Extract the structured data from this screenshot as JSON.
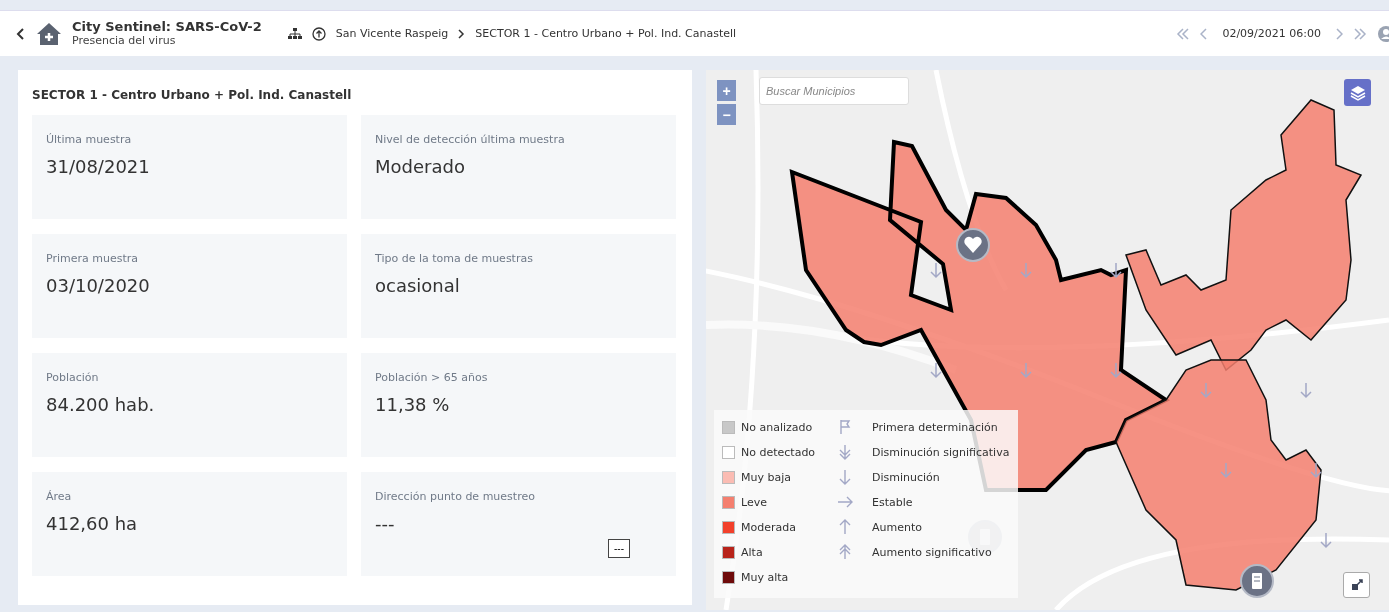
{
  "header": {
    "title": "City Sentinel: SARS-CoV-2",
    "subtitle": "Presencia del virus",
    "breadcrumbs": [
      "San Vicente Raspeig",
      "SECTOR 1 - Centro Urbano + Pol. Ind. Canastell"
    ],
    "date": "02/09/2021 06:00"
  },
  "panel": {
    "title": "SECTOR 1 - Centro Urbano + Pol. Ind. Canastell",
    "cards": [
      {
        "label": "Última muestra",
        "value": "31/08/2021"
      },
      {
        "label": "Nivel de detección última muestra",
        "value": "Moderado"
      },
      {
        "label": "Primera muestra",
        "value": "03/10/2020"
      },
      {
        "label": "Tipo de la toma de muestras",
        "value": "ocasional"
      },
      {
        "label": "Población",
        "value": "84.200 hab."
      },
      {
        "label": "Población > 65 años",
        "value": "11,38 %"
      },
      {
        "label": "Área",
        "value": "412,60 ha"
      },
      {
        "label": "Dirección punto de muestreo",
        "value": "---",
        "button": "---"
      }
    ]
  },
  "map": {
    "search": {
      "placeholder": "Buscar Municipios"
    },
    "zoom_in": "+",
    "zoom_out": "−",
    "legend_levels": [
      {
        "label": "No analizado",
        "color": "#c8c8c8"
      },
      {
        "label": "No detectado",
        "color": "#ffffff"
      },
      {
        "label": "Muy baja",
        "color": "#fbbcb3"
      },
      {
        "label": "Leve",
        "color": "#f47f6f"
      },
      {
        "label": "Moderada",
        "color": "#f2402b"
      },
      {
        "label": "Alta",
        "color": "#b8231a"
      },
      {
        "label": "Muy alta",
        "color": "#6e0a0a"
      }
    ],
    "legend_trends": [
      {
        "label": "Primera determinación",
        "kind": "flag"
      },
      {
        "label": "Disminución significativa",
        "kind": "down2"
      },
      {
        "label": "Disminución",
        "kind": "down"
      },
      {
        "label": "Estable",
        "kind": "right"
      },
      {
        "label": "Aumento",
        "kind": "up"
      },
      {
        "label": "Aumento significativo",
        "kind": "up2"
      }
    ]
  }
}
